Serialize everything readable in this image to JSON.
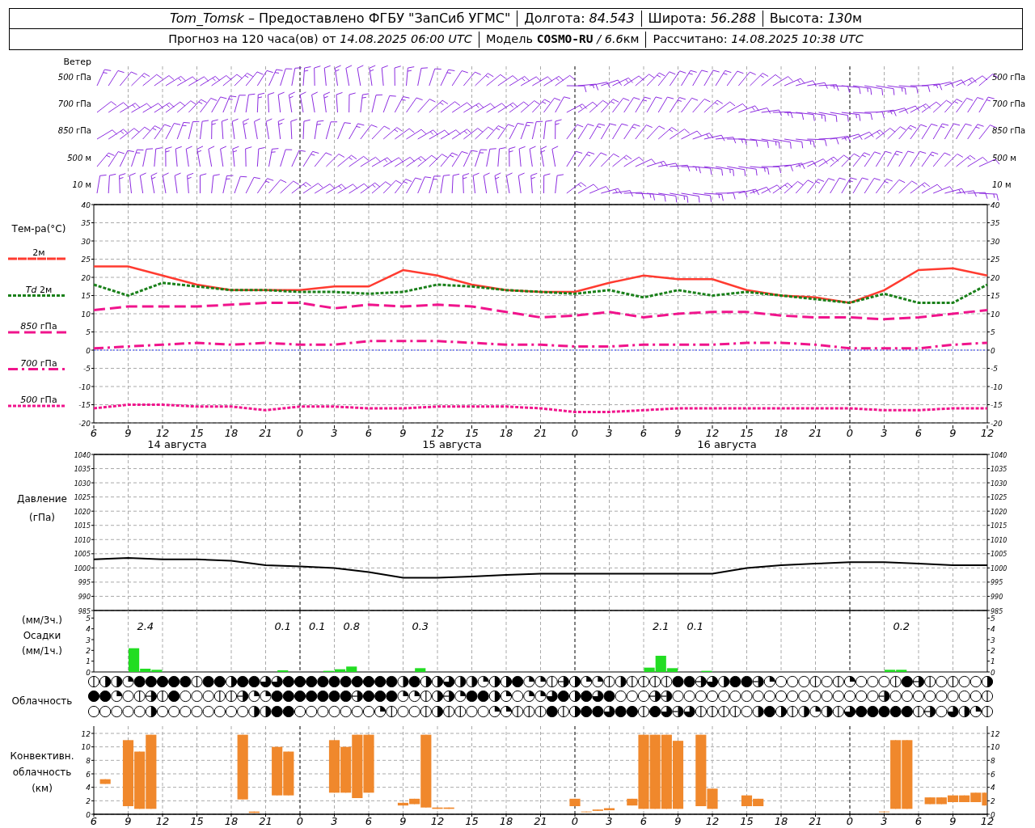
{
  "header": {
    "line1": [
      [
        {
          "text": "Tom_Tomsk",
          "italic": true
        },
        {
          "text": " – Предоставлено ФГБУ \"ЗапСиб УГМС\""
        }
      ],
      [
        {
          "text": "Долгота: "
        },
        {
          "text": "84.543",
          "italic": true
        }
      ],
      [
        {
          "text": "Широта: "
        },
        {
          "text": "56.288",
          "italic": true
        }
      ],
      [
        {
          "text": "Высота: "
        },
        {
          "text": "130",
          "italic": true
        },
        {
          "text": "м"
        }
      ]
    ],
    "line2": [
      [
        {
          "text": "Прогноз на 120 часа(ов) от "
        },
        {
          "text": "14.08.2025 06:00 UTC",
          "italic": true
        }
      ],
      [
        {
          "text": "Модель "
        },
        {
          "text": "COSMO-RU",
          "bold": true
        },
        {
          "text": " / 6.6",
          "italic": true
        },
        {
          "text": "км"
        }
      ],
      [
        {
          "text": "Рассчитано: "
        },
        {
          "text": "14.08.2025 10:38 UTC",
          "italic": true
        }
      ]
    ]
  },
  "wind": {
    "label": "Ветер",
    "levels_left": [
      "*500* гПа",
      "*700* гПа",
      "*850* гПа",
      "*500* м",
      "*10* м"
    ],
    "levels_right": [
      "*500* гПа",
      "*700* гПа",
      "*850* гПа",
      "*500* м",
      "*10* м"
    ]
  },
  "temperature": {
    "date_labels": [
      "14 августа",
      "15 августа",
      "16 августа"
    ],
    "chart_data": {
      "type": "line",
      "title": "Тем-ра(°C)",
      "grid": true,
      "categories": [
        "6",
        "9",
        "12",
        "15",
        "18",
        "21",
        "0",
        "3",
        "6",
        "9",
        "12",
        "15",
        "18",
        "21",
        "0",
        "3",
        "6",
        "9",
        "12",
        "15",
        "18",
        "21",
        "0",
        "3",
        "6",
        "9",
        "12"
      ],
      "ylim": [
        -20,
        40
      ],
      "yticks": [
        40,
        35,
        30,
        25,
        20,
        15,
        10,
        5,
        0,
        -5,
        -10,
        -15,
        -20
      ],
      "y2lim": [
        -20,
        40
      ],
      "y2ticks": [
        40,
        35,
        30,
        25,
        20,
        15,
        10,
        5,
        0,
        -5,
        -10,
        -15,
        -20
      ],
      "ref_lines": [
        {
          "axis": "y",
          "value": 0,
          "color": "#3344ff"
        }
      ],
      "legend": true,
      "series": [
        {
          "name": "2м",
          "color": "#ff3b30",
          "line_style": "solid",
          "values": [
            23,
            23,
            20.5,
            18,
            16.5,
            16.5,
            16.5,
            17.5,
            17.5,
            22,
            20.5,
            18,
            16.5,
            16,
            16,
            18.5,
            20.5,
            19.5,
            19.5,
            16.5,
            15,
            14.5,
            13,
            16.5,
            22,
            22.5,
            20.5
          ]
        },
        {
          "name": "*Td* 2м",
          "color": "#1a801a",
          "line_style": "dotted",
          "values": [
            18,
            15,
            18.5,
            17.5,
            16.5,
            16.5,
            16,
            16,
            15.5,
            16,
            18,
            17.5,
            16.5,
            16,
            15.5,
            16.5,
            14.5,
            16.5,
            15,
            16,
            15,
            14,
            13,
            15.5,
            13,
            13,
            18
          ]
        },
        {
          "name": "*850* гПа",
          "color": "#f0148c",
          "line_style": "dashed",
          "values": [
            11,
            12,
            12,
            12,
            12.5,
            13,
            13,
            11.5,
            12.5,
            12,
            12.5,
            12,
            10.5,
            9,
            9.5,
            10.5,
            9,
            10,
            10.5,
            10.5,
            9.5,
            9,
            9,
            8.5,
            9,
            10,
            11
          ]
        },
        {
          "name": "*700* гПа",
          "color": "#f0148c",
          "line_style": "dashdot",
          "values": [
            0.5,
            1,
            1.5,
            2,
            1.5,
            2,
            1.5,
            1.5,
            2.5,
            2.5,
            2.5,
            2,
            1.5,
            1.5,
            1,
            1,
            1.5,
            1.5,
            1.5,
            2,
            2,
            1.5,
            0.5,
            0.5,
            0.5,
            1.5,
            2
          ]
        },
        {
          "name": "*500* гПа",
          "color": "#f0148c",
          "line_style": "dotted",
          "values": [
            -16,
            -15,
            -15,
            -15.5,
            -15.5,
            -16.5,
            -15.5,
            -15.5,
            -16,
            -16,
            -15.5,
            -15.5,
            -15.5,
            -16,
            -17,
            -17,
            -16.5,
            -16,
            -16,
            -16,
            -16,
            -16,
            -16,
            -16.5,
            -16.5,
            -16,
            -16
          ]
        }
      ]
    }
  },
  "pressure": {
    "unit": "(гПа)",
    "chart_data": {
      "type": "line",
      "ylabel": "Давление",
      "grid": true,
      "ylim": [
        985,
        1040
      ],
      "yticks": [
        1040,
        1035,
        1030,
        1025,
        1020,
        1015,
        1010,
        1005,
        1000,
        995,
        990,
        985
      ],
      "y2lim": [
        985,
        1040
      ],
      "y2ticks": [
        1040,
        1035,
        1030,
        1025,
        1020,
        1015,
        1010,
        1005,
        1000,
        995,
        990,
        985
      ],
      "series": [
        {
          "color": "#000000",
          "values": [
            1003,
            1003.5,
            1003,
            1003,
            1002.5,
            1001,
            1000.5,
            1000,
            998.5,
            996.5,
            996.5,
            997,
            997.5,
            998,
            998,
            998,
            998,
            998,
            998,
            1000,
            1001,
            1001.5,
            1002,
            1002,
            1001.5,
            1001,
            1001
          ]
        }
      ]
    }
  },
  "precipitation": {
    "unit_3h": "(мм/3ч.)",
    "unit_1h": "(мм/1ч.)",
    "chart_data": {
      "type": "bar",
      "ylabel": "Осадки",
      "grid": true,
      "values": [
        null,
        null,
        null,
        2.2,
        0.3,
        0.2,
        null,
        null,
        null,
        null,
        null,
        null,
        null,
        null,
        null,
        null,
        0.15,
        null,
        null,
        null,
        0.1,
        0.25,
        0.5,
        null,
        null,
        null,
        null,
        null,
        0.35,
        null,
        null,
        null,
        null,
        null,
        null,
        null,
        null,
        null,
        null,
        null,
        null,
        null,
        null,
        null,
        null,
        null,
        null,
        null,
        0.4,
        1.5,
        0.35,
        null,
        null,
        0.1,
        null,
        null,
        null,
        null,
        null,
        null,
        null,
        null,
        null,
        null,
        null,
        null,
        null,
        null,
        null,
        0.2,
        0.2,
        null,
        null,
        null,
        null,
        null,
        null,
        null
      ],
      "ylim": [
        0,
        5.7
      ],
      "yticks": [
        5,
        4,
        3,
        2,
        1,
        0
      ],
      "y2lim": [
        0,
        5.7
      ],
      "y2ticks": [
        5,
        4,
        3,
        2,
        1,
        0
      ],
      "annotations": [
        "2.4",
        "0.1",
        "0.1",
        "0.8",
        "0.3",
        "2.1",
        "0.1",
        "0.2"
      ]
    }
  },
  "clouds": {
    "label": "Облачность",
    "rows": [
      {
        "cells": [
          {
            "kind": "line"
          },
          {
            "kind": "half"
          },
          {
            "kind": "half"
          },
          {
            "kind": "quarter"
          },
          {
            "kind": "full"
          },
          {
            "kind": "full"
          },
          {
            "kind": "full"
          },
          {
            "kind": "full"
          },
          {
            "kind": "full"
          },
          {
            "kind": "line"
          },
          {
            "kind": "full"
          },
          {
            "kind": "full"
          },
          {
            "kind": "half"
          },
          {
            "kind": "full"
          },
          {
            "kind": "full"
          },
          {
            "kind": "threequarter"
          },
          {
            "kind": "threequarter"
          },
          {
            "kind": "full"
          },
          {
            "kind": "full"
          },
          {
            "kind": "full"
          },
          {
            "kind": "full"
          },
          {
            "kind": "full"
          },
          {
            "kind": "full"
          },
          {
            "kind": "full"
          },
          {
            "kind": "full"
          },
          {
            "kind": "full"
          },
          {
            "kind": "full"
          },
          {
            "kind": "half"
          },
          {
            "kind": "full"
          },
          {
            "kind": "half"
          },
          {
            "kind": "half"
          },
          {
            "kind": "threequarter"
          },
          {
            "kind": "half"
          },
          {
            "kind": "half"
          },
          {
            "kind": "quarter"
          },
          {
            "kind": "half"
          },
          {
            "kind": "half"
          },
          {
            "kind": "full"
          },
          {
            "kind": "quarter"
          },
          {
            "kind": "quarter"
          },
          {
            "kind": "line"
          },
          {
            "kind": "halfline"
          },
          {
            "kind": "half"
          },
          {
            "kind": "quarter"
          },
          {
            "kind": "quarter"
          },
          {
            "kind": "line"
          },
          {
            "kind": "half"
          },
          {
            "kind": "line"
          },
          {
            "kind": "line"
          },
          {
            "kind": "line"
          },
          {
            "kind": "line"
          },
          {
            "kind": "full"
          },
          {
            "kind": "full"
          },
          {
            "kind": "halfline"
          },
          {
            "kind": "threequarter"
          },
          {
            "kind": "half"
          },
          {
            "kind": "full"
          },
          {
            "kind": "full"
          },
          {
            "kind": "halfline"
          },
          {
            "kind": "quarter"
          },
          {
            "kind": "empty"
          },
          {
            "kind": "empty"
          },
          {
            "kind": "empty"
          },
          {
            "kind": "line"
          },
          {
            "kind": "empty"
          },
          {
            "kind": "line"
          },
          {
            "kind": "quarter"
          },
          {
            "kind": "empty"
          },
          {
            "kind": "empty"
          },
          {
            "kind": "empty"
          },
          {
            "kind": "line"
          },
          {
            "kind": "full"
          },
          {
            "kind": "halfline"
          },
          {
            "kind": "line"
          },
          {
            "kind": "empty"
          },
          {
            "kind": "line"
          },
          {
            "kind": "empty"
          },
          {
            "kind": "empty"
          },
          {
            "kind": "half"
          }
        ]
      },
      {
        "cells": [
          {
            "kind": "full"
          },
          {
            "kind": "full"
          },
          {
            "kind": "quarter"
          },
          {
            "kind": "empty"
          },
          {
            "kind": "line"
          },
          {
            "kind": "halfline"
          },
          {
            "kind": "line"
          },
          {
            "kind": "full"
          },
          {
            "kind": "empty"
          },
          {
            "kind": "empty"
          },
          {
            "kind": "empty"
          },
          {
            "kind": "line"
          },
          {
            "kind": "line"
          },
          {
            "kind": "halfline"
          },
          {
            "kind": "quarter"
          },
          {
            "kind": "quarter"
          },
          {
            "kind": "full"
          },
          {
            "kind": "full"
          },
          {
            "kind": "full"
          },
          {
            "kind": "full"
          },
          {
            "kind": "full"
          },
          {
            "kind": "full"
          },
          {
            "kind": "full"
          },
          {
            "kind": "halfline"
          },
          {
            "kind": "full"
          },
          {
            "kind": "full"
          },
          {
            "kind": "full"
          },
          {
            "kind": "quarter"
          },
          {
            "kind": "quarter"
          },
          {
            "kind": "line"
          },
          {
            "kind": "half"
          },
          {
            "kind": "halfline"
          },
          {
            "kind": "quarter"
          },
          {
            "kind": "full"
          },
          {
            "kind": "full"
          },
          {
            "kind": "half"
          },
          {
            "kind": "quarter"
          },
          {
            "kind": "empty"
          },
          {
            "kind": "quarter"
          },
          {
            "kind": "quarter"
          },
          {
            "kind": "threequarter"
          },
          {
            "kind": "full"
          },
          {
            "kind": "half"
          },
          {
            "kind": "full"
          },
          {
            "kind": "threequarter"
          },
          {
            "kind": "full"
          },
          {
            "kind": "empty"
          },
          {
            "kind": "empty"
          },
          {
            "kind": "empty"
          },
          {
            "kind": "halfline"
          },
          {
            "kind": "halfline"
          },
          {
            "kind": "empty"
          },
          {
            "kind": "empty"
          },
          {
            "kind": "empty"
          },
          {
            "kind": "empty"
          },
          {
            "kind": "empty"
          },
          {
            "kind": "empty"
          },
          {
            "kind": "empty"
          },
          {
            "kind": "empty"
          },
          {
            "kind": "empty"
          },
          {
            "kind": "empty"
          },
          {
            "kind": "empty"
          },
          {
            "kind": "empty"
          },
          {
            "kind": "empty"
          },
          {
            "kind": "empty"
          },
          {
            "kind": "empty"
          },
          {
            "kind": "empty"
          },
          {
            "kind": "empty"
          },
          {
            "kind": "empty"
          },
          {
            "kind": "halfline"
          },
          {
            "kind": "empty"
          },
          {
            "kind": "empty"
          },
          {
            "kind": "empty"
          },
          {
            "kind": "empty"
          },
          {
            "kind": "empty"
          },
          {
            "kind": "empty"
          },
          {
            "kind": "empty"
          },
          {
            "kind": "empty"
          },
          {
            "kind": "line"
          }
        ]
      },
      {
        "cells": [
          {
            "kind": "empty"
          },
          {
            "kind": "empty"
          },
          {
            "kind": "empty"
          },
          {
            "kind": "empty"
          },
          {
            "kind": "empty"
          },
          {
            "kind": "half"
          },
          {
            "kind": "empty"
          },
          {
            "kind": "empty"
          },
          {
            "kind": "empty"
          },
          {
            "kind": "empty"
          },
          {
            "kind": "empty"
          },
          {
            "kind": "empty"
          },
          {
            "kind": "empty"
          },
          {
            "kind": "empty"
          },
          {
            "kind": "half"
          },
          {
            "kind": "half"
          },
          {
            "kind": "full"
          },
          {
            "kind": "full"
          },
          {
            "kind": "empty"
          },
          {
            "kind": "empty"
          },
          {
            "kind": "empty"
          },
          {
            "kind": "empty"
          },
          {
            "kind": "empty"
          },
          {
            "kind": "empty"
          },
          {
            "kind": "empty"
          },
          {
            "kind": "quarter"
          },
          {
            "kind": "line"
          },
          {
            "kind": "empty"
          },
          {
            "kind": "empty"
          },
          {
            "kind": "line"
          },
          {
            "kind": "half"
          },
          {
            "kind": "line"
          },
          {
            "kind": "line"
          },
          {
            "kind": "empty"
          },
          {
            "kind": "empty"
          },
          {
            "kind": "quarter"
          },
          {
            "kind": "quarter"
          },
          {
            "kind": "line"
          },
          {
            "kind": "line"
          },
          {
            "kind": "line"
          },
          {
            "kind": "full"
          },
          {
            "kind": "line"
          },
          {
            "kind": "half"
          },
          {
            "kind": "full"
          },
          {
            "kind": "full"
          },
          {
            "kind": "threequarter"
          },
          {
            "kind": "full"
          },
          {
            "kind": "full"
          },
          {
            "kind": "line"
          },
          {
            "kind": "full"
          },
          {
            "kind": "threequarter"
          },
          {
            "kind": "halfline"
          },
          {
            "kind": "threequarter"
          },
          {
            "kind": "line"
          },
          {
            "kind": "line"
          },
          {
            "kind": "line"
          },
          {
            "kind": "line"
          },
          {
            "kind": "empty"
          },
          {
            "kind": "half"
          },
          {
            "kind": "full"
          },
          {
            "kind": "half"
          },
          {
            "kind": "line"
          },
          {
            "kind": "half"
          },
          {
            "kind": "quarter"
          },
          {
            "kind": "half"
          },
          {
            "kind": "line"
          },
          {
            "kind": "threequarter"
          },
          {
            "kind": "full"
          },
          {
            "kind": "full"
          },
          {
            "kind": "full"
          },
          {
            "kind": "full"
          },
          {
            "kind": "full"
          },
          {
            "kind": "line"
          },
          {
            "kind": "halfline"
          },
          {
            "kind": "empty"
          },
          {
            "kind": "threequarter"
          },
          {
            "kind": "half"
          },
          {
            "kind": "quarter"
          },
          {
            "kind": "line"
          }
        ]
      }
    ]
  },
  "convective": {
    "label_lines": [
      "Конвективн.",
      "облачность",
      "(км)"
    ],
    "chart_data": {
      "type": "candlestick",
      "grid": true,
      "categories": [
        "6",
        null,
        null,
        "9",
        null,
        null,
        "12",
        null,
        null,
        "15",
        null,
        null,
        "18",
        null,
        null,
        "21",
        null,
        null,
        "0",
        null,
        null,
        "3",
        null,
        null,
        "6",
        null,
        null,
        "9",
        null,
        null,
        "12",
        null,
        null,
        "15",
        null,
        null,
        "18",
        null,
        null,
        "21",
        null,
        null,
        "0",
        null,
        null,
        "3",
        null,
        null,
        "6",
        null,
        null,
        "9",
        null,
        null,
        "12",
        null,
        null,
        "15",
        null,
        null,
        "18",
        null,
        null,
        "21",
        null,
        null,
        "0",
        null,
        null,
        "3",
        null,
        null,
        "6",
        null,
        null,
        "9",
        null,
        null,
        "12"
      ],
      "ylim": [
        0,
        12
      ],
      "yticks": [
        12,
        10,
        8,
        6,
        4,
        2,
        0
      ],
      "y2lim": [
        0,
        12
      ],
      "y2ticks": [
        12,
        10,
        8,
        6,
        4,
        2,
        0
      ],
      "ohlc": [
        null,
        [
          4.5,
          5.2,
          4.5,
          5.2
        ],
        null,
        [
          1.2,
          11,
          1.2,
          11
        ],
        [
          0.8,
          9.3,
          0.8,
          9.3
        ],
        [
          0.8,
          11.8,
          0.8,
          11.8
        ],
        null,
        null,
        null,
        null,
        null,
        null,
        null,
        [
          2.2,
          11.8,
          2.2,
          11.8
        ],
        [
          0.2,
          0.4,
          0.2,
          0.4
        ],
        null,
        [
          2.8,
          10,
          2.8,
          10
        ],
        [
          2.8,
          9.3,
          2.8,
          9.3
        ],
        null,
        null,
        null,
        [
          3.2,
          11,
          3.2,
          11
        ],
        [
          3.2,
          10,
          3.2,
          10
        ],
        [
          2.4,
          11.8,
          2.4,
          11.8
        ],
        [
          3.2,
          11.8,
          3.2,
          11.8
        ],
        null,
        null,
        [
          1.3,
          1.7,
          1.3,
          1.7
        ],
        [
          1.5,
          2.3,
          1.5,
          2.3
        ],
        [
          1,
          11.8,
          1,
          11.8
        ],
        [
          0.8,
          1,
          0.8,
          1
        ],
        [
          0.8,
          1,
          0.8,
          1
        ],
        null,
        null,
        null,
        null,
        null,
        null,
        null,
        null,
        null,
        null,
        [
          1.2,
          2.3,
          1.2,
          2.3
        ],
        [
          0.3,
          0.4,
          0.3,
          0.4
        ],
        [
          0.5,
          0.7,
          0.5,
          0.7
        ],
        [
          0.6,
          0.9,
          0.6,
          0.9
        ],
        null,
        [
          1.3,
          2.3,
          1.3,
          2.3
        ],
        [
          0.8,
          11.8,
          0.8,
          11.8
        ],
        [
          0.8,
          11.8,
          0.8,
          11.8
        ],
        [
          0.8,
          11.8,
          0.8,
          11.8
        ],
        [
          0.8,
          10.9,
          0.8,
          10.9
        ],
        null,
        [
          1.2,
          11.8,
          1.2,
          11.8
        ],
        [
          0.8,
          3.8,
          0.8,
          3.8
        ],
        null,
        null,
        [
          1.2,
          2.8,
          1.2,
          2.8
        ],
        [
          1.2,
          2.3,
          1.2,
          2.3
        ],
        null,
        null,
        null,
        null,
        null,
        null,
        null,
        null,
        null,
        null,
        [
          0.3,
          0.4,
          0.3,
          0.4
        ],
        [
          0.8,
          11,
          0.8,
          11
        ],
        [
          0.8,
          11,
          0.8,
          11
        ],
        null,
        [
          1.5,
          2.5,
          1.5,
          2.5
        ],
        [
          1.5,
          2.5,
          1.5,
          2.5
        ],
        [
          1.8,
          2.8,
          1.8,
          2.8
        ],
        [
          1.8,
          2.8,
          1.8,
          2.8
        ],
        [
          1.8,
          3.2,
          1.8,
          3.2
        ],
        [
          1.3,
          3.2,
          1.3,
          3.2
        ]
      ]
    }
  }
}
